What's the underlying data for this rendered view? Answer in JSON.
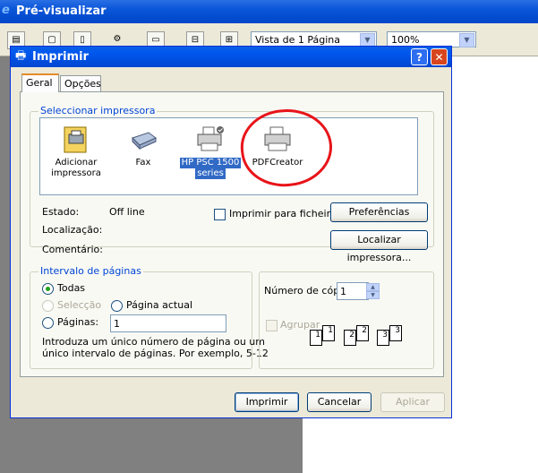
{
  "background_window": {
    "title": "Pré-visualizar",
    "zoom_select": "Vista de 1 Página",
    "percent_select": "100%"
  },
  "dialog": {
    "title": "Imprimir",
    "help_label": "?",
    "close_label": "✕",
    "tabs": [
      {
        "label": "Geral",
        "active": true
      },
      {
        "label": "Opções",
        "active": false
      }
    ],
    "select_printer": {
      "group_label": "Seleccionar impressora",
      "printers": [
        {
          "name_line1": "Adicionar",
          "name_line2": "impressora",
          "icon": "add-printer-icon"
        },
        {
          "name_line1": "Fax",
          "name_line2": "",
          "icon": "fax-icon"
        },
        {
          "name_line1": "HP PSC 1500",
          "name_line2": "series",
          "icon": "printer-default-icon",
          "selected": true
        },
        {
          "name_line1": "PDFCreator",
          "name_line2": "",
          "icon": "printer-icon"
        }
      ],
      "status_label": "Estado:",
      "status_value": "Off line",
      "location_label": "Localização:",
      "comment_label": "Comentário:",
      "print_to_file_label": "Imprimir para ficheiro",
      "preferences_button": "Preferências",
      "find_printer_button": "Localizar impressora..."
    },
    "page_range": {
      "group_label": "Intervalo de páginas",
      "all_label": "Todas",
      "selection_label": "Selecção",
      "current_page_label": "Página actual",
      "pages_label": "Páginas:",
      "pages_value": "1",
      "hint": "Introduza um único número de página ou um",
      "hint_line2": "único intervalo de páginas. Por exemplo, 5-12"
    },
    "copies": {
      "label": "Número de cópias:",
      "value": "1",
      "collate_label": "Agrupar"
    },
    "buttons": {
      "print": "Imprimir",
      "cancel": "Cancelar",
      "apply": "Aplicar"
    }
  },
  "colors": {
    "annotation_circle": "#e8141a",
    "xp_blue": "#0058ee",
    "group_label": "#0046d5"
  }
}
